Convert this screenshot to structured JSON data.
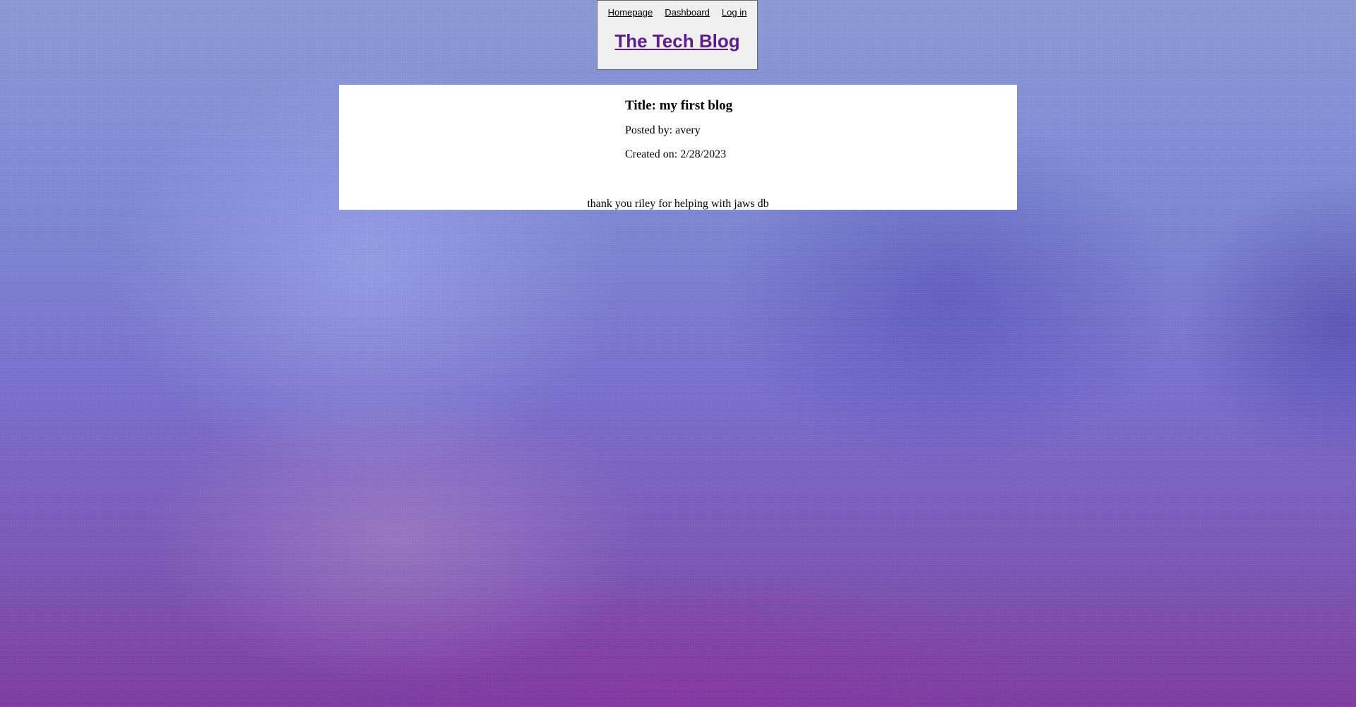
{
  "nav": {
    "homepage": "Homepage",
    "dashboard": "Dashboard",
    "login": "Log in"
  },
  "site": {
    "title": "The Tech Blog"
  },
  "post": {
    "title": "Title: my first blog",
    "author": "Posted by: avery",
    "created": "Created on: 2/28/2023",
    "body": "thank you riley for helping with jaws db"
  },
  "colors": {
    "header_bg": "#efefef",
    "title_link": "#5e1c8f",
    "post_bg": "#ffffff"
  }
}
